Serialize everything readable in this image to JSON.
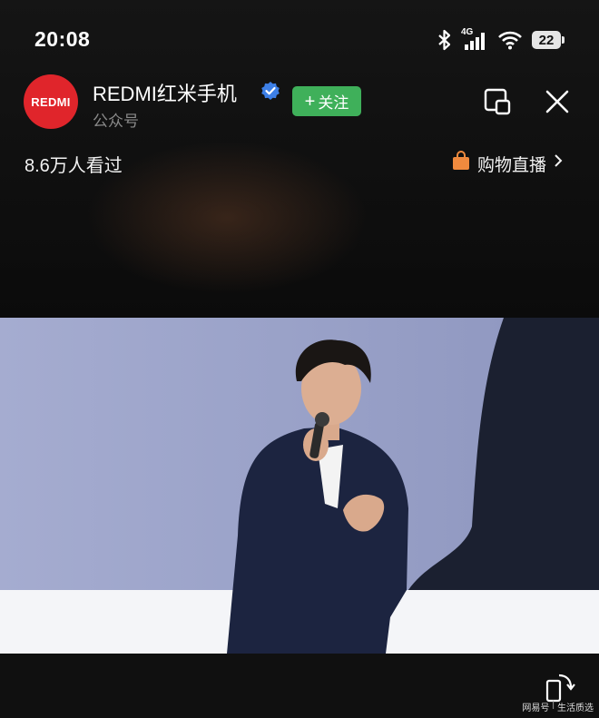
{
  "status_bar": {
    "time": "20:08",
    "network": "4G",
    "battery": "22",
    "icons": [
      "bluetooth-icon",
      "signal-icon",
      "wifi-icon",
      "battery-icon"
    ]
  },
  "account": {
    "avatar_text": "REDMI",
    "name": "REDMI红米手机",
    "type": "公众号",
    "follow_label": "关注",
    "brand_color": "#e0252b",
    "follow_color": "#3fb05a",
    "verified_color": "#3d7fe6"
  },
  "live": {
    "viewers": "8.6万人看过",
    "shop_label": "购物直播",
    "shop_icon_color": "#f08a3e"
  },
  "watermark": {
    "left": "网易号",
    "right": "生活质选"
  }
}
